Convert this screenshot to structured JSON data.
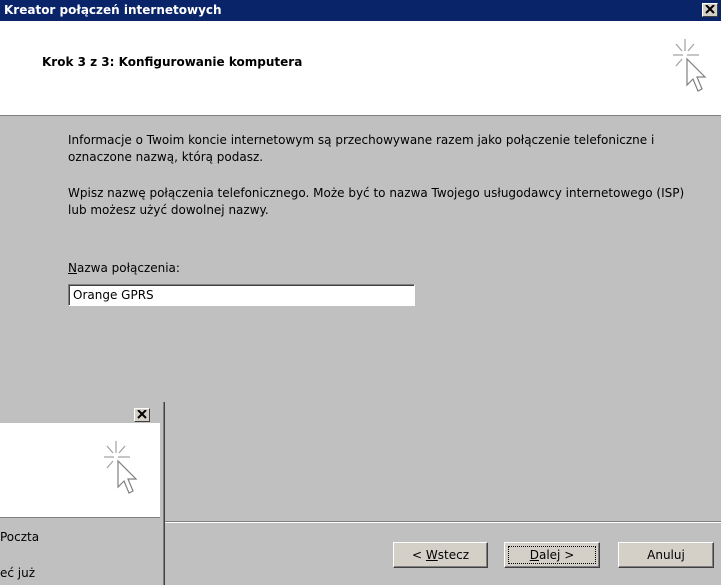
{
  "window": {
    "title": "Kreator połączeń internetowych",
    "header_title": "Krok 3 z 3: Konfigurowanie komputera"
  },
  "content": {
    "paragraph1": "Informacje o Twoim koncie internetowym są przechowywane razem jako połączenie telefoniczne i oznaczone nazwą, którą podasz.",
    "paragraph2": "Wpisz nazwę połączenia telefonicznego. Może być to nazwa Twojego usługodawcy internetowego (ISP) lub możesz użyć dowolnej nazwy.",
    "field_label_accel": "N",
    "field_label_rest": "azwa połączenia:",
    "connection_name_value": "Orange GPRS"
  },
  "buttons": {
    "back_prefix": "< ",
    "back_accel": "W",
    "back_rest": "stecz",
    "next_accel": "D",
    "next_rest": "alej >",
    "cancel": "Anuluj"
  },
  "background_dialog": {
    "text_fragment_1": "Poczta",
    "text_fragment_2": "eć już"
  },
  "colors": {
    "titlebar": "#0a246a",
    "dialog_face": "#c0c0c0",
    "header_bg": "#ffffff"
  }
}
